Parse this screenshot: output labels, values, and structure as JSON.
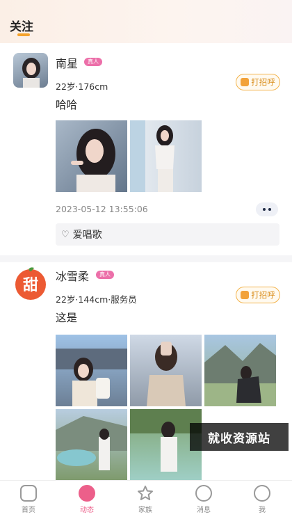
{
  "header": {
    "tab_label": "关注"
  },
  "posts": [
    {
      "name": "南星",
      "badge": "真人",
      "meta": "22岁·176cm",
      "text": "哈哈",
      "greet_label": "打招呼",
      "timestamp": "2023-05-12 13:55:06",
      "topic": "爱唱歌"
    },
    {
      "name": "冰雪柔",
      "avatar_text": "甜",
      "badge": "真人",
      "meta": "22岁·144cm·服务员",
      "text": "这是",
      "greet_label": "打招呼"
    }
  ],
  "watermark": "就收资源站",
  "nav": {
    "items": [
      {
        "label": "首页",
        "icon": "home-icon"
      },
      {
        "label": "动态",
        "icon": "moments-icon",
        "active": true
      },
      {
        "label": "家族",
        "icon": "star-icon"
      },
      {
        "label": "消息",
        "icon": "message-icon"
      },
      {
        "label": "我",
        "icon": "profile-icon"
      }
    ]
  },
  "colors": {
    "accent": "#f5a32c",
    "pink": "#ec5f8a",
    "greet_border": "#f3b34b"
  }
}
